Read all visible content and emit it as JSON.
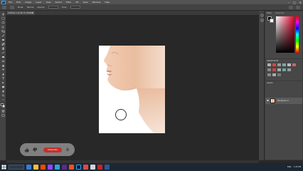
{
  "menubar": {
    "app_logo": "Ps",
    "items": [
      "File",
      "Edit",
      "Image",
      "Layer",
      "Type",
      "Select",
      "Filter",
      "3D",
      "View",
      "Window",
      "Help"
    ],
    "window_controls": [
      "–",
      "□",
      "✕"
    ]
  },
  "optionsbar": {
    "mode_label": "Mode:",
    "mode_value": "Normal",
    "opacity_label": "Opacity:",
    "flow_label": "Flow:"
  },
  "document": {
    "tab_title": "Untitled-1 @ 66.7% (RGB/8)",
    "close": "×"
  },
  "colors": {
    "foreground": "#000000",
    "background": "#ffffff",
    "picker_hue": "#e8002a"
  },
  "panels": {
    "color_tab": "Color",
    "swatches_tab": "Swatches",
    "adjustments_tab": "Adjustments",
    "layers_tab": "Layers",
    "layer_name": "Background"
  },
  "overlay": {
    "like_icon": "thumbs-up-icon",
    "dislike_icon": "thumbs-down-icon",
    "subscribe_label": "Subscribe",
    "bell_icon": "bell-icon"
  },
  "taskbar": {
    "time": "7:25 PM",
    "lang": "ENG"
  }
}
